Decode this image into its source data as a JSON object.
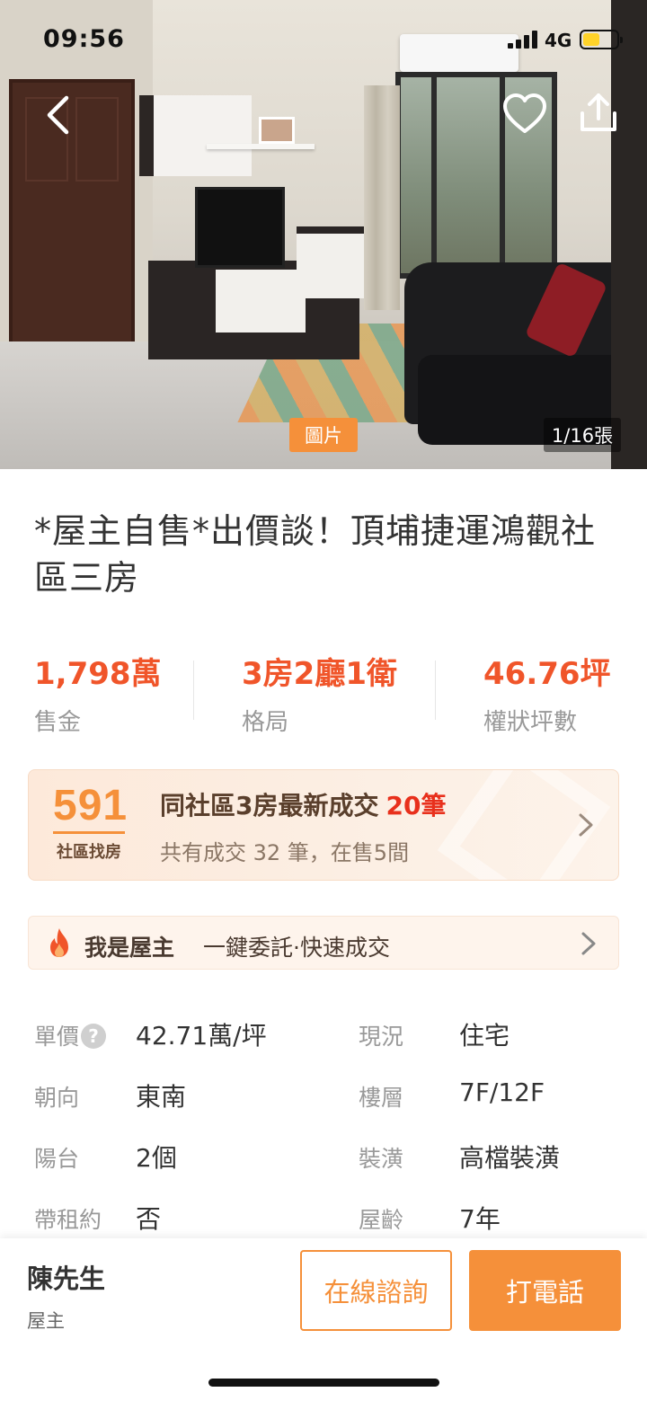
{
  "status_bar": {
    "time": "09:56",
    "network": "4G"
  },
  "gallery": {
    "tag_label": "圖片",
    "counter": "1/16張",
    "back_icon": "chevron-left-icon",
    "favorite_icon": "heart-icon",
    "share_icon": "share-icon"
  },
  "listing": {
    "title": "*屋主自售*出價談！頂埔捷運鴻觀社區三房"
  },
  "stats": [
    {
      "value": "1,798萬",
      "label": "售金"
    },
    {
      "value": "3房2廳1衛",
      "label": "格局"
    },
    {
      "value": "46.76坪",
      "label": "權狀坪數"
    }
  ],
  "community": {
    "logo_number": "591",
    "logo_caption": "社區找房",
    "headline": "同社區3房最新成交",
    "headline_highlight": "20筆",
    "subline": "共有成交 32 筆，在售5間"
  },
  "owner_banner": {
    "label": "我是屋主",
    "description": "一鍵委託·快速成交"
  },
  "details": [
    {
      "left_key": "單價",
      "left_value": "42.71萬/坪",
      "right_key": "現況",
      "right_value": "住宅"
    },
    {
      "left_key": "朝向",
      "left_value": "東南",
      "right_key": "樓層",
      "right_value": "7F/12F"
    },
    {
      "left_key": "陽台",
      "left_value": "2個",
      "right_key": "裝潢",
      "right_value": "高檔裝潢"
    },
    {
      "left_key": "帶租約",
      "left_value": "否",
      "right_key": "屋齡",
      "right_value": "7年"
    }
  ],
  "details_help_mark": "?",
  "contact": {
    "name": "陳先生",
    "role": "屋主",
    "online_label": "在線諮詢",
    "call_label": "打電話"
  },
  "colors": {
    "accent": "#f5903a",
    "price": "#f0552a",
    "highlight": "#e8301c"
  }
}
